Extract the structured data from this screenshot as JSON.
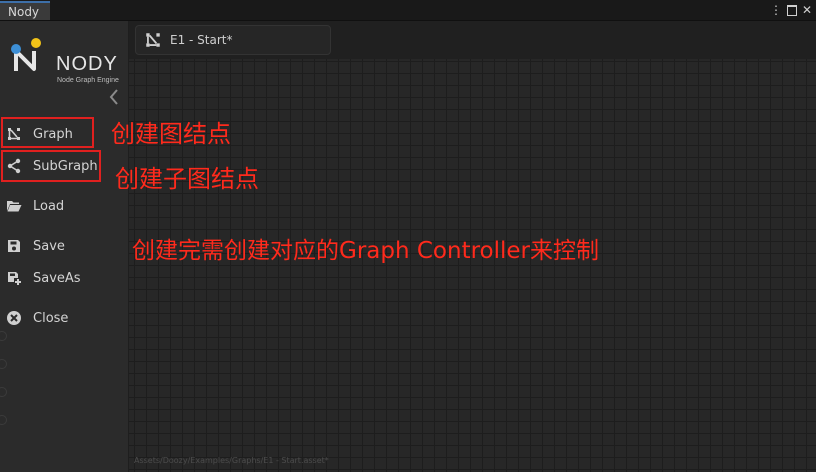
{
  "window": {
    "tab_title": "Nody",
    "icons": [
      "more-vertical-icon",
      "maximize-icon",
      "close-icon"
    ]
  },
  "logo": {
    "name": "NODY",
    "subtitle": "Node Graph Engine",
    "colors": {
      "blue": "#3d8fd6",
      "yellow": "#f2c318",
      "white": "#e6e6e6"
    }
  },
  "sidebar": {
    "items": [
      {
        "label": "Graph",
        "icon": "graph-icon"
      },
      {
        "label": "SubGraph",
        "icon": "subgraph-icon"
      },
      {
        "label": "Load",
        "icon": "folder-open-icon"
      },
      {
        "label": "Save",
        "icon": "save-icon"
      },
      {
        "label": "SaveAs",
        "icon": "save-as-icon"
      },
      {
        "label": "Close",
        "icon": "close-circle-icon"
      }
    ]
  },
  "canvas": {
    "tab_title": "E1 - Start*",
    "asset_path": "Assets/Doozy/Examples/Graphs/E1 - Start.asset*"
  },
  "annotations": {
    "graph": "创建图结点",
    "subgraph": "创建子图结点",
    "controller": "创建完需创建对应的Graph Controller来控制",
    "color": "#ff2a1c"
  }
}
